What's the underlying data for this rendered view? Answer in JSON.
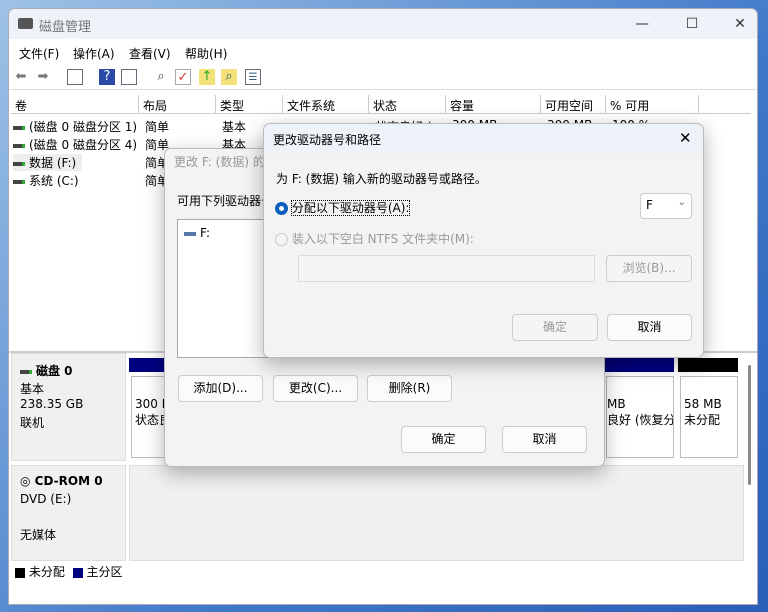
{
  "window": {
    "title": "磁盘管理",
    "minimize": "—",
    "maximize": "☐",
    "close": "✕"
  },
  "menu": [
    "文件(F)",
    "操作(A)",
    "查看(V)",
    "帮助(H)"
  ],
  "columns": [
    "卷",
    "布局",
    "类型",
    "文件系统",
    "状态",
    "容量",
    "可用空间",
    "% 可用"
  ],
  "rows": [
    {
      "vol": "(磁盘 0 磁盘分区 1)",
      "layout": "简单",
      "type": "基本",
      "fs": "",
      "status": "状态良好 (",
      "cap": "300 MB",
      "free": "300 MB",
      "pct": "100 %"
    },
    {
      "vol": "(磁盘 0 磁盘分区 4)",
      "layout": "简单",
      "type": "基本"
    },
    {
      "vol": "数据 (F:)",
      "layout": "简单"
    },
    {
      "vol": "系统 (C:)",
      "layout": "简单"
    }
  ],
  "disk0": {
    "name": "磁盘 0",
    "kind": "基本",
    "size": "238.35 GB",
    "state": "联机",
    "p1_size": "300 M",
    "p1_status": "状态良",
    "p4_size": "MB",
    "p4_status": "良好 (恢复分",
    "un_size": "58 MB",
    "un_status": "未分配"
  },
  "cdrom": {
    "name": "CD-ROM 0",
    "kind": "DVD (E:)",
    "state": "无媒体"
  },
  "legend": {
    "unalloc": "未分配",
    "primary": "主分区"
  },
  "bg_dialog": {
    "title": "更改 F: (数据) 的驱动器号和路径",
    "prompt": "可用下列驱动器号和路径:",
    "item": "F:",
    "add": "添加(D)...",
    "change": "更改(C)...",
    "remove": "删除(R)",
    "ok": "确定",
    "cancel": "取消"
  },
  "dialog": {
    "title": "更改驱动器号和路径",
    "close": "✕",
    "instruction": "为 F: (数据) 输入新的驱动器号或路径。",
    "assign_label": "分配以下驱动器号(A):",
    "letter": "F",
    "mount_label": "装入以下空白 NTFS 文件夹中(M):",
    "path_value": "",
    "browse": "浏览(B)...",
    "ok": "确定",
    "cancel": "取消"
  }
}
